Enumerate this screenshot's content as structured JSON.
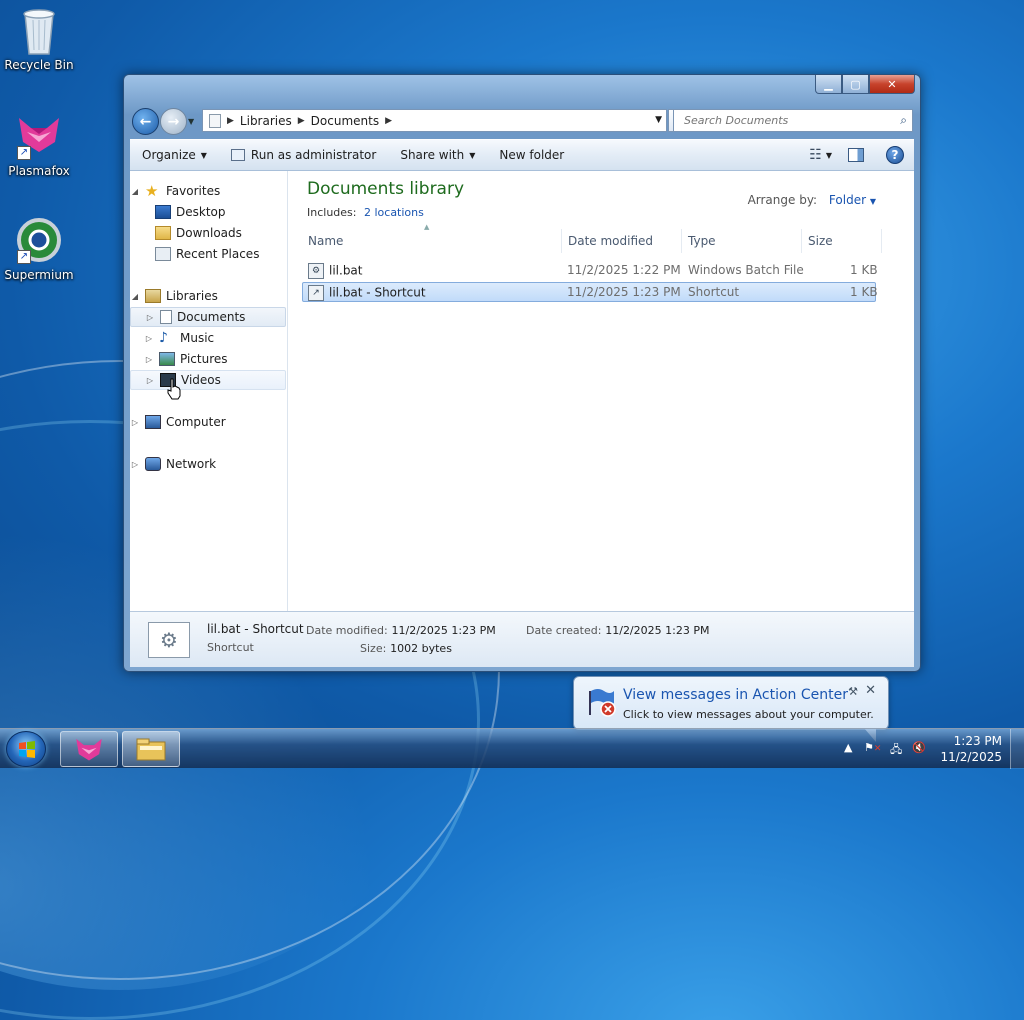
{
  "desktop": {
    "icons": [
      {
        "label": "Recycle Bin"
      },
      {
        "label": "Plasmafox"
      },
      {
        "label": "Supermium"
      }
    ]
  },
  "window": {
    "address": {
      "segments": [
        "Libraries",
        "Documents"
      ]
    },
    "search": {
      "placeholder": "Search Documents"
    },
    "toolbar": {
      "organize": "Organize",
      "run_as_admin": "Run as administrator",
      "share_with": "Share with",
      "new_folder": "New folder"
    },
    "nav": {
      "favorites": "Favorites",
      "desktop": "Desktop",
      "downloads": "Downloads",
      "recent_places": "Recent Places",
      "libraries": "Libraries",
      "documents": "Documents",
      "music": "Music",
      "pictures": "Pictures",
      "videos": "Videos",
      "computer": "Computer",
      "network": "Network"
    },
    "library": {
      "title": "Documents library",
      "includes_label": "Includes:",
      "includes_link": "2 locations",
      "arrange_label": "Arrange by:",
      "arrange_value": "Folder"
    },
    "columns": {
      "name": "Name",
      "date_modified": "Date modified",
      "type": "Type",
      "size": "Size"
    },
    "files": [
      {
        "name": "lil.bat",
        "date": "11/2/2025 1:22 PM",
        "type": "Windows Batch File",
        "size": "1 KB"
      },
      {
        "name": "lil.bat - Shortcut",
        "date": "11/2/2025 1:23 PM",
        "type": "Shortcut",
        "size": "1 KB"
      }
    ],
    "details": {
      "name": "lil.bat - Shortcut",
      "type": "Shortcut",
      "date_modified_label": "Date modified:",
      "date_modified": "11/2/2025 1:23 PM",
      "date_created_label": "Date created:",
      "date_created": "11/2/2025 1:23 PM",
      "size_label": "Size:",
      "size": "1002 bytes"
    }
  },
  "notification": {
    "title": "View messages in Action Center",
    "text": "Click to view messages about your computer."
  },
  "taskbar": {
    "time": "1:23 PM",
    "date": "11/2/2025"
  },
  "colors": {
    "library_title": "#1e6b1e",
    "link": "#1a55b0",
    "selection": "#c1dbfa"
  }
}
